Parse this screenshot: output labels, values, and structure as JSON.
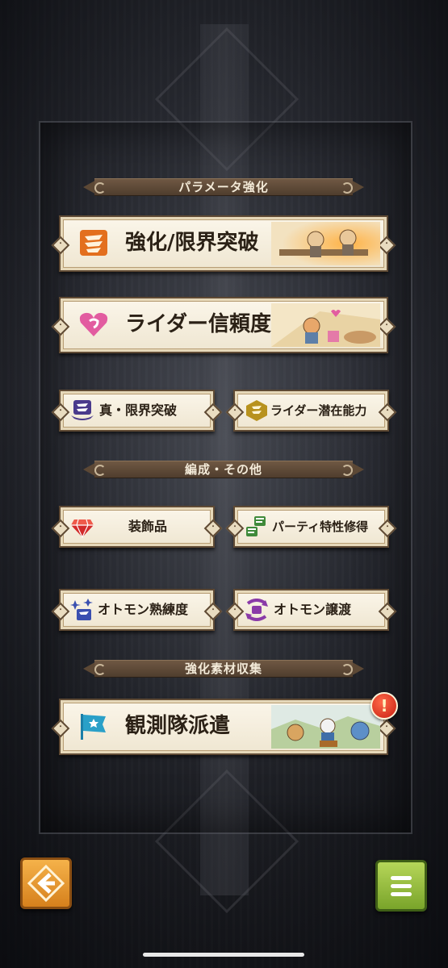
{
  "sections": {
    "parameter": "パラメータ強化",
    "formation": "編成・その他",
    "materials": "強化素材収集"
  },
  "buttons": {
    "enhance": "強化/限界突破",
    "rider_trust": "ライダー信頼度",
    "true_limit": "真・限界突破",
    "rider_potential": "ライダー潜在能力",
    "decorations": "装飾品",
    "party_trait": "パーティ特性修得",
    "otomon_proficiency": "オトモン熟練度",
    "otomon_transfer": "オトモン譲渡",
    "observation_dispatch": "観測隊派遣"
  },
  "badge": {
    "alert": "!"
  },
  "icons": {
    "enhance": "orange-claw-icon",
    "rider_trust": "pink-heart-icon",
    "true_limit": "purple-winged-claw-icon",
    "rider_potential": "gold-hexagon-icon",
    "decorations": "red-gem-icon",
    "party_trait": "green-claw-icon",
    "otomon_proficiency": "blue-sparkle-icon",
    "otomon_transfer": "purple-transfer-icon",
    "observation_dispatch": "blue-flag-icon",
    "back": "back-arrow-icon",
    "menu": "hamburger-menu-icon"
  },
  "colors": {
    "ribbon": "#5c4835",
    "button_bg": "#fbf6ea",
    "button_border": "#5f4a34",
    "back_button": "#e89a2e",
    "menu_button": "#8fb83a",
    "alert": "#d9261a"
  }
}
